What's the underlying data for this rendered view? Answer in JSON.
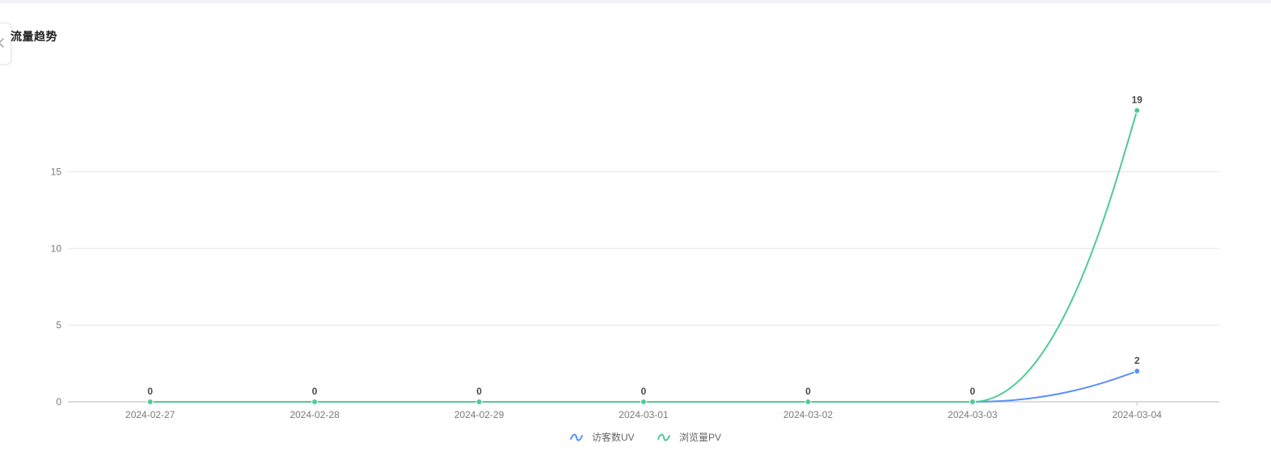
{
  "card": {
    "title": "流量趋势"
  },
  "icons": {
    "collapse": "chevron-left-icon"
  },
  "chart_data": {
    "type": "line",
    "smooth": true,
    "categories": [
      "2024-02-27",
      "2024-02-28",
      "2024-02-29",
      "2024-03-01",
      "2024-03-02",
      "2024-03-03",
      "2024-03-04"
    ],
    "y_ticks": [
      0,
      5,
      10,
      15
    ],
    "ylim": [
      0,
      20
    ],
    "grid": true,
    "legend_position": "bottom-center",
    "series": [
      {
        "name": "访客数UV",
        "color": "#5b8ff9",
        "values": [
          0,
          0,
          0,
          0,
          0,
          0,
          2
        ],
        "labels": [
          null,
          null,
          null,
          null,
          null,
          null,
          "2"
        ]
      },
      {
        "name": "浏览量PV",
        "color": "#4ecb93",
        "values": [
          0,
          0,
          0,
          0,
          0,
          0,
          19
        ],
        "labels": [
          "0",
          "0",
          "0",
          "0",
          "0",
          "0",
          "19"
        ]
      }
    ]
  }
}
